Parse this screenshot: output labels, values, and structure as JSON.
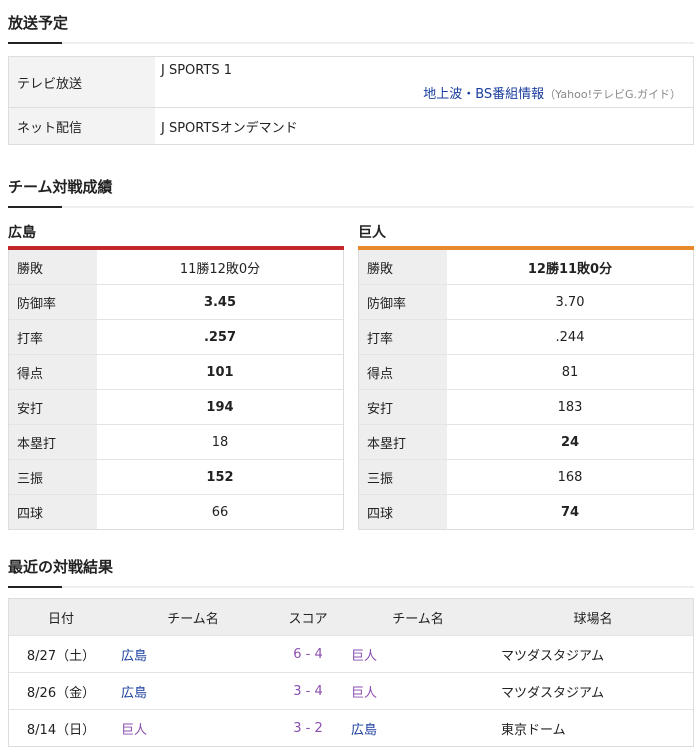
{
  "broadcast": {
    "title": "放送予定",
    "tv_label": "テレビ放送",
    "tv_channel": "J SPORTS 1",
    "tv_info_link": "地上波・BS番組情報",
    "tv_info_source": "（Yahoo!テレビG.ガイド）",
    "net_label": "ネット配信",
    "net_value": "J SPORTSオンデマンド"
  },
  "team_record": {
    "title": "チーム対戦成績",
    "home": {
      "name": "広島",
      "bar_color": "#c0282d",
      "rows": [
        {
          "label": "勝敗",
          "value": "11勝12敗0分"
        },
        {
          "label": "防御率",
          "value": "3.45"
        },
        {
          "label": "打率",
          "value": ".257"
        },
        {
          "label": "得点",
          "value": "101"
        },
        {
          "label": "安打",
          "value": "194"
        },
        {
          "label": "本塁打",
          "value": "18"
        },
        {
          "label": "三振",
          "value": "152"
        },
        {
          "label": "四球",
          "value": "66"
        }
      ]
    },
    "away": {
      "name": "巨人",
      "bar_color": "#e88a2c",
      "rows": [
        {
          "label": "勝敗",
          "value": "12勝11敗0分"
        },
        {
          "label": "防御率",
          "value": "3.70"
        },
        {
          "label": "打率",
          "value": ".244"
        },
        {
          "label": "得点",
          "value": "81"
        },
        {
          "label": "安打",
          "value": "183"
        },
        {
          "label": "本塁打",
          "value": "24"
        },
        {
          "label": "三振",
          "value": "168"
        },
        {
          "label": "四球",
          "value": "74"
        }
      ]
    }
  },
  "recent": {
    "title": "最近の対戦結果",
    "headers": [
      "日付",
      "チーム名",
      "スコア",
      "チーム名",
      "球場名"
    ],
    "rows": [
      {
        "date": "8/27（土）",
        "team1": "広島",
        "score": "6 - 4",
        "team2": "巨人",
        "stadium": "マツダスタジアム"
      },
      {
        "date": "8/26（金）",
        "team1": "広島",
        "score": "3 - 4",
        "team2": "巨人",
        "stadium": "マツダスタジアム"
      },
      {
        "date": "8/14（日）",
        "team1": "巨人",
        "score": "3 - 2",
        "team2": "広島",
        "stadium": "東京ドーム"
      }
    ]
  }
}
